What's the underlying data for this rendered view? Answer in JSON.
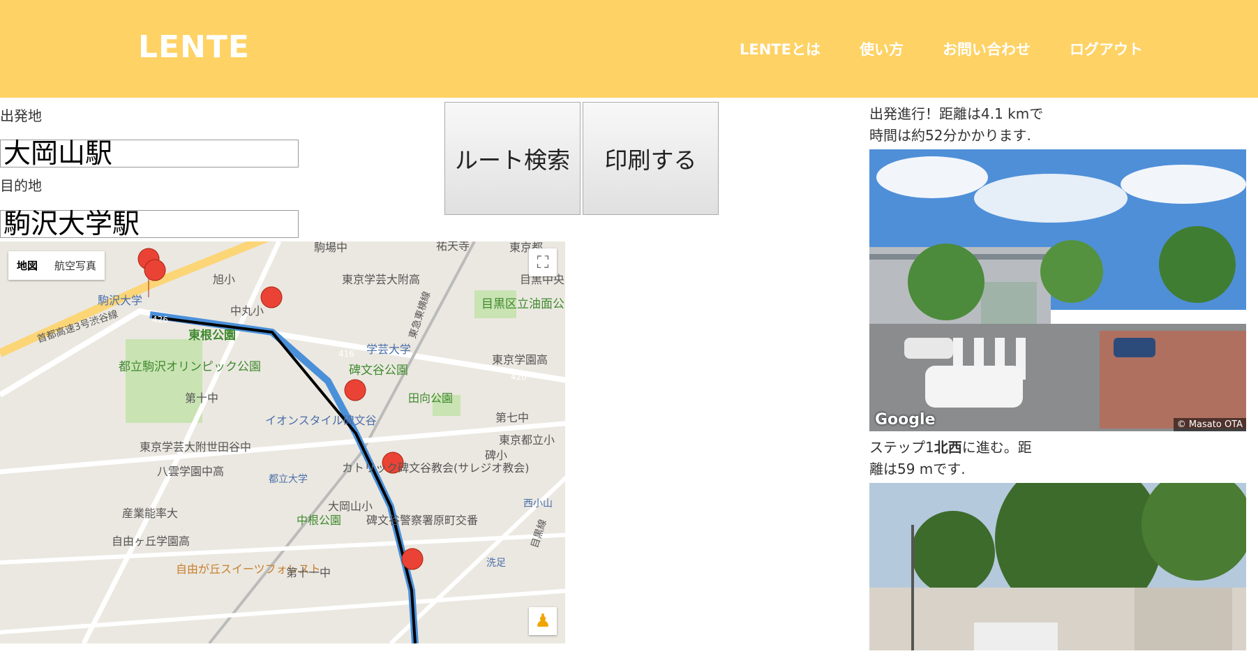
{
  "header": {
    "logo": "LENTE",
    "nav": [
      "LENTEとは",
      "使い方",
      "お問い合わせ",
      "ログアウト"
    ],
    "background": "#fed264"
  },
  "form": {
    "origin_label": "出発地",
    "origin_value": "大岡山駅",
    "destination_label": "目的地",
    "destination_value": "駒沢大学駅",
    "search_button": "ルート検索",
    "print_button": "印刷する"
  },
  "map": {
    "toggle": [
      "地図",
      "航空写真"
    ],
    "labels": [
      "駒沢大学",
      "旭小",
      "中丸小",
      "東京学芸大附高",
      "祐天寺",
      "目黒中央",
      "東根公園",
      "都立駒沢オリンピック公園",
      "学芸大学",
      "目黒区立油面公園",
      "碑文谷公園",
      "東京学園高",
      "第十中",
      "田向公園",
      "イオンスタイル碑文谷",
      "第七中",
      "東京学芸大附世田谷中",
      "碑小",
      "東京都立小",
      "八雲学園中高",
      "都立大学",
      "カトリック碑文谷教会(サレジオ教会)",
      "大岡山小",
      "西小山",
      "産業能率大",
      "中根公園",
      "碑文谷警察署原町交番",
      "自由ヶ丘学園高",
      "自由が丘スイーツフォレスト",
      "第十一中",
      "洗足",
      "首都高速3号渋谷線",
      "東急東横線",
      "目黒線",
      "426",
      "416",
      "420",
      "駒場中",
      "東京都"
    ],
    "route_color": "#4a90d9",
    "marker_color": "#ea4335"
  },
  "directions": {
    "summary_line1": "出発進行！距離は4.1 kmで",
    "summary_line2": "時間は約52分かかります.",
    "step1_prefix": "ステップ1",
    "step1_dir": "北西",
    "step1_suffix": "に進む。距",
    "step1_line2": "離は59 mです.",
    "google": "Google",
    "credit": "© Masato OTA"
  }
}
